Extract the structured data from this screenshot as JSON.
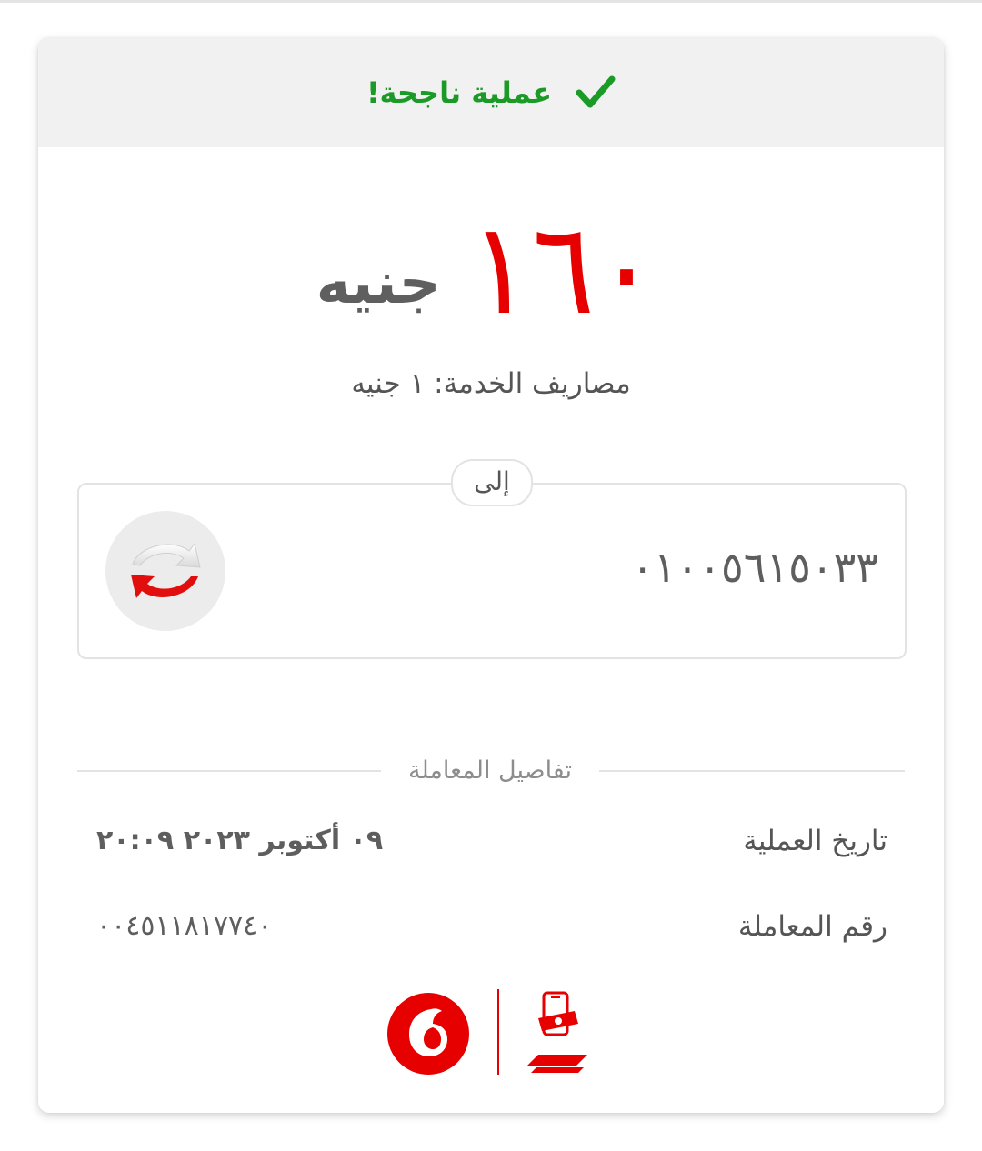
{
  "status": {
    "text": "عملية ناجحة!",
    "icon": "check-icon",
    "color": "#1b9a27"
  },
  "amount": {
    "value": "١٦٠",
    "currency": "جنيه",
    "color": "#e60000"
  },
  "service_fee": "مصاريف الخدمة: ١ جنيه",
  "recipient": {
    "label": "إلى",
    "number": "٠١٠٠٥٦١٥٠٣٣",
    "icon": "transfer-arrows-icon"
  },
  "details": {
    "title": "تفاصيل المعاملة",
    "rows": [
      {
        "label": "تاريخ العملية",
        "value": "٠٩ أكتوبر ٢٠٢٣ ٢٠:٠٩"
      },
      {
        "label": "رقم المعاملة",
        "value": "٠٠٤٥١١٨١٧٧٤٠"
      }
    ]
  },
  "branding": {
    "left_logo": "vodafone-logo",
    "right_logo": "vodafone-cash-logo",
    "brand_color": "#e60000"
  }
}
